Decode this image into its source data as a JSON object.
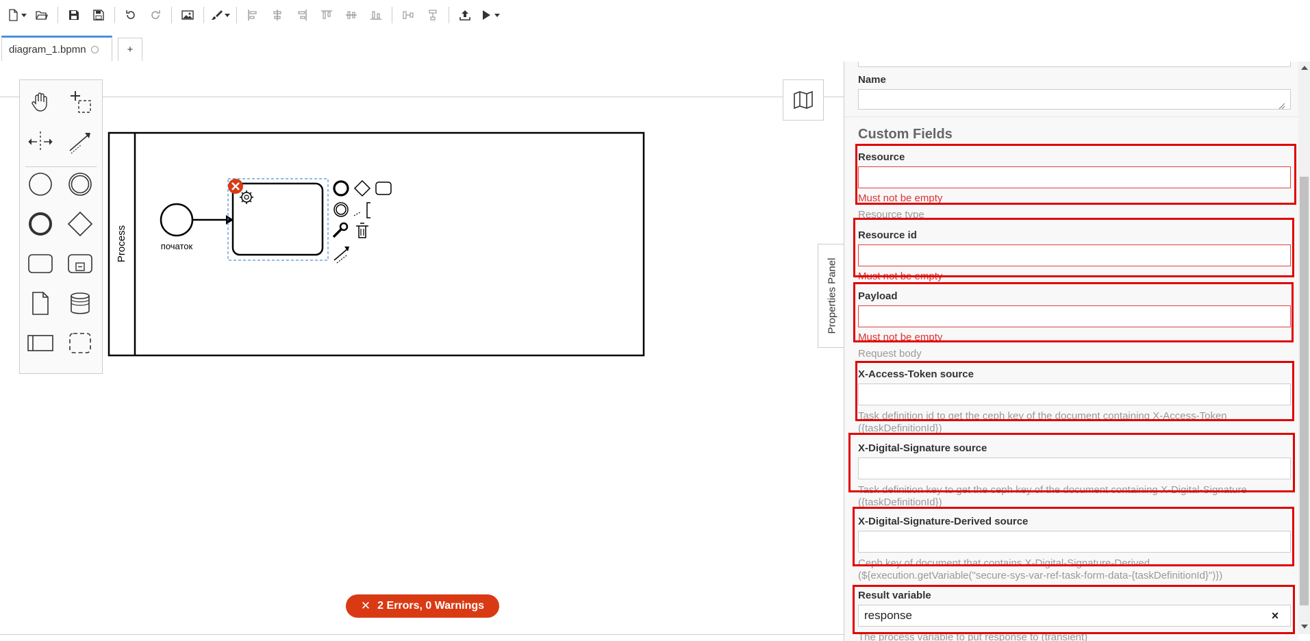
{
  "tab": {
    "name": "diagram_1.bpmn",
    "add_label": "+"
  },
  "diagram": {
    "pool_label": "Process",
    "start_event_label": "початок"
  },
  "errors": {
    "text": "2 Errors, 0 Warnings"
  },
  "properties_toggle_label": "Properties Panel",
  "panel": {
    "name_label": "Name",
    "name_value": "",
    "section_title": "Custom Fields",
    "fields": {
      "resource": {
        "label": "Resource",
        "value": "",
        "error": "Must not be empty",
        "description": "Resource type"
      },
      "resource_id": {
        "label": "Resource id",
        "value": "",
        "error": "Must not be empty"
      },
      "payload": {
        "label": "Payload",
        "value": "",
        "error": "Must not be empty",
        "description": "Request body"
      },
      "x_access_token": {
        "label": "X-Access-Token source",
        "value": "",
        "description": "Task definition id to get the ceph key of the document containing X-Access-Token ({taskDefinitionId})"
      },
      "x_digital_signature": {
        "label": "X-Digital-Signature source",
        "value": "",
        "description": "Task definition key to get the ceph key of the document containing X-Digital-Signature ({taskDefinitionId})"
      },
      "x_digital_signature_derived": {
        "label": "X-Digital-Signature-Derived source",
        "value": "",
        "description": "Ceph key of document that contains X-Digital-Signature-Derived (${execution.getVariable(\"secure-sys-var-ref-task-form-data-{taskDefinitionId}\")})"
      },
      "result_variable": {
        "label": "Result variable",
        "value": "response",
        "clear_label": "×",
        "description": "The process variable to put response to (transient)"
      }
    }
  },
  "colors": {
    "error": "#d93a14",
    "highlight": "#e00000",
    "tab_accent": "#4a90d9"
  }
}
